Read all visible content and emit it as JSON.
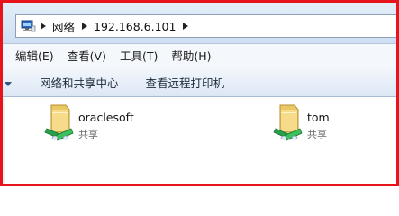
{
  "address_bar": {
    "breadcrumbs": [
      "网络",
      "192.168.6.101"
    ]
  },
  "menu": {
    "items": [
      "编辑(E)",
      "查看(V)",
      "工具(T)",
      "帮助(H)"
    ]
  },
  "command_bar": {
    "items": [
      "网络和共享中心",
      "查看远程打印机"
    ]
  },
  "shares": [
    {
      "name": "oraclesoft",
      "type": "共享",
      "icon": "shared-folder-icon"
    },
    {
      "name": "tom",
      "type": "共享",
      "icon": "shared-folder-icon"
    }
  ],
  "colors": {
    "frame_border": "#e8141b",
    "toolbar_gradient_top": "#f3f7fc",
    "toolbar_gradient_bottom": "#dce7f5"
  }
}
